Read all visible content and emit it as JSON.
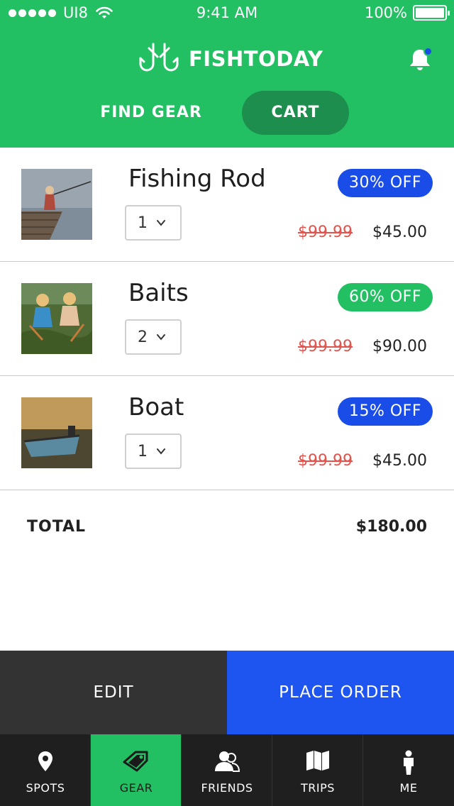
{
  "status_bar": {
    "carrier": "UI8",
    "time": "9:41 AM",
    "battery": "100%",
    "icons": [
      "signal-dots-icon",
      "wifi-icon",
      "battery-icon"
    ]
  },
  "app": {
    "title": "FISHTODAY",
    "logo_icon": "fish-hooks-logo-icon",
    "notification_icon": "bell-icon"
  },
  "tabs": [
    {
      "label": "FIND GEAR",
      "active": false
    },
    {
      "label": "CART",
      "active": true
    }
  ],
  "cart": {
    "items": [
      {
        "name": "Fishing Rod",
        "quantity": "1",
        "discount": "30% OFF",
        "discount_color": "#1a4de8",
        "old_price": "$99.99",
        "new_price": "$45.00",
        "image": "child-fishing-on-dock-photo"
      },
      {
        "name": "Baits",
        "quantity": "2",
        "discount": "60% OFF",
        "discount_color": "#23c063",
        "old_price": "$99.99",
        "new_price": "$90.00",
        "image": "kids-playing-in-grass-photo"
      },
      {
        "name": "Boat",
        "quantity": "1",
        "discount": "15% OFF",
        "discount_color": "#1a4de8",
        "old_price": "$99.99",
        "new_price": "$45.00",
        "image": "boat-at-sunset-photo"
      }
    ],
    "total_label": "TOTAL",
    "total_value": "$180.00"
  },
  "actions": {
    "edit_label": "EDIT",
    "order_label": "PLACE ORDER"
  },
  "nav": [
    {
      "label": "SPOTS",
      "icon": "map-pin-icon",
      "active": false
    },
    {
      "label": "GEAR",
      "icon": "tag-icon",
      "active": true
    },
    {
      "label": "FRIENDS",
      "icon": "friends-icon",
      "active": false
    },
    {
      "label": "TRIPS",
      "icon": "map-icon",
      "active": false
    },
    {
      "label": "ME",
      "icon": "person-icon",
      "active": false
    }
  ],
  "colors": {
    "brand_green": "#23c063",
    "active_tab_bg": "#1d8e4e",
    "accent_blue": "#1e54f0",
    "strike_red": "#e0554e",
    "edit_bg": "#333333",
    "nav_bg": "#1f1f1f"
  }
}
